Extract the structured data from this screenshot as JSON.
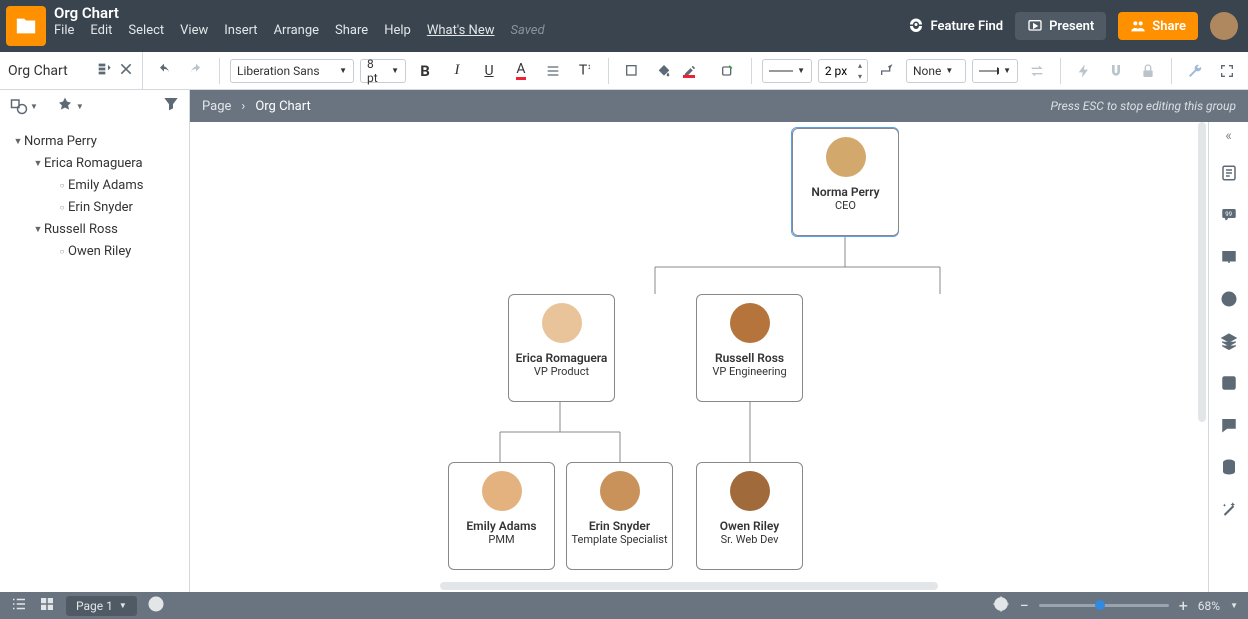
{
  "header": {
    "doc_title": "Org Chart",
    "menus": [
      "File",
      "Edit",
      "Select",
      "View",
      "Insert",
      "Arrange",
      "Share",
      "Help"
    ],
    "whats_new": "What's New",
    "saved": "Saved",
    "feature_find": "Feature Find",
    "present": "Present",
    "share": "Share"
  },
  "outline_title": "Org Chart",
  "toolbar": {
    "font": "Liberation Sans",
    "font_size": "8 pt",
    "line_width": "2 px",
    "line_end": "None"
  },
  "breadcrumb": {
    "page": "Page",
    "current": "Org Chart",
    "hint": "Press ESC to stop editing this group"
  },
  "outline": [
    {
      "level": 1,
      "type": "caret",
      "label": "Norma Perry"
    },
    {
      "level": 2,
      "type": "caret",
      "label": "Erica Romaguera"
    },
    {
      "level": 3,
      "type": "bullet",
      "label": "Emily Adams"
    },
    {
      "level": 3,
      "type": "bullet",
      "label": "Erin Snyder"
    },
    {
      "level": 2,
      "type": "caret",
      "label": "Russell Ross"
    },
    {
      "level": 3,
      "type": "bullet",
      "label": "Owen Riley"
    }
  ],
  "nodes": {
    "n0": {
      "name": "Norma Perry",
      "role": "CEO"
    },
    "n1": {
      "name": "Erica Romaguera",
      "role": "VP Product"
    },
    "n2": {
      "name": "Russell Ross",
      "role": "VP Engineering"
    },
    "n3": {
      "name": "Emily Adams",
      "role": "PMM"
    },
    "n4": {
      "name": "Erin Snyder",
      "role": "Template Specialist"
    },
    "n5": {
      "name": "Owen Riley",
      "role": "Sr. Web Dev"
    }
  },
  "footer": {
    "page_tab": "Page 1",
    "zoom": "68%"
  },
  "chart_data": {
    "type": "tree",
    "title": "Org Chart",
    "nodes": [
      {
        "id": "n0",
        "name": "Norma Perry",
        "role": "CEO",
        "parent": null
      },
      {
        "id": "n1",
        "name": "Erica Romaguera",
        "role": "VP Product",
        "parent": "n0"
      },
      {
        "id": "n2",
        "name": "Russell Ross",
        "role": "VP Engineering",
        "parent": "n0"
      },
      {
        "id": "n3",
        "name": "Emily Adams",
        "role": "PMM",
        "parent": "n1"
      },
      {
        "id": "n4",
        "name": "Erin Snyder",
        "role": "Template Specialist",
        "parent": "n1"
      },
      {
        "id": "n5",
        "name": "Owen Riley",
        "role": "Sr. Web Dev",
        "parent": "n2"
      }
    ]
  }
}
